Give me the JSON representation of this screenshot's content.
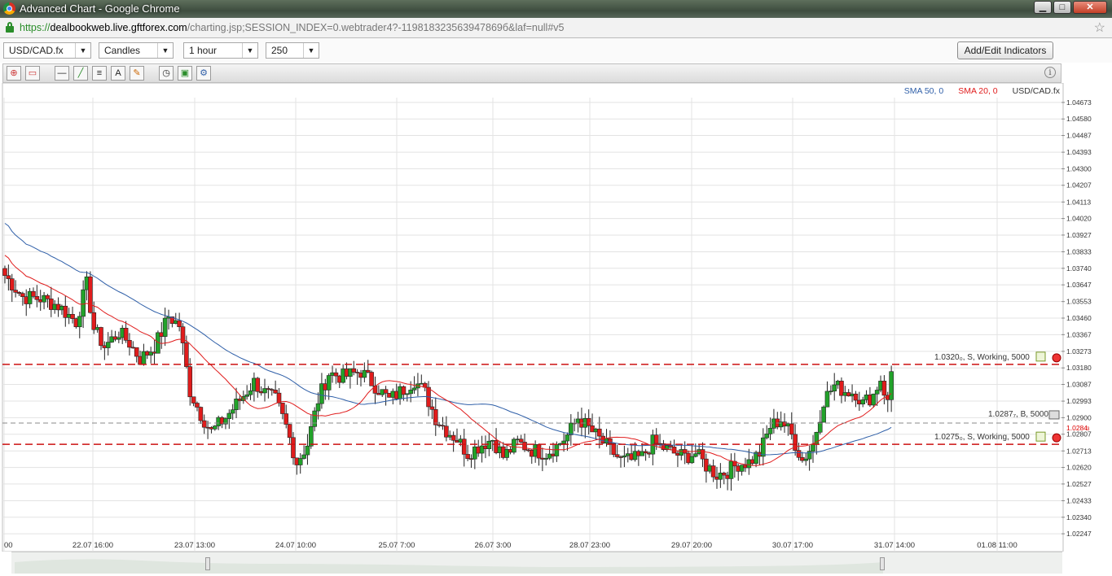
{
  "window": {
    "title": "Advanced Chart - Google Chrome",
    "minimize": "▁",
    "maximize": "□",
    "close": "✕"
  },
  "address": {
    "scheme": "https://",
    "host": "dealbookweb.live.gftforex.com",
    "path": "/charting.jsp;SESSION_INDEX=0.webtrader4?-119818323563947869б&laf=null#v5"
  },
  "toolbar": {
    "symbol": "USD/CAD.fx",
    "chart_type": "Candles",
    "interval": "1 hour",
    "bars": "250",
    "add_indicators": "Add/Edit Indicators"
  },
  "colors": {
    "up": "#22a22a",
    "down": "#e01c1c",
    "sma50": "#2f5fa8",
    "sma20": "#e01c1c",
    "grid": "#e3e3e3"
  },
  "chart_data": {
    "type": "candlestick",
    "legend": [
      {
        "name": "SMA 50, 0",
        "color": "#2f5fa8"
      },
      {
        "name": "SMA 20, 0",
        "color": "#e01c1c"
      },
      {
        "name": "USD/CAD.fx",
        "color": "#333333"
      }
    ],
    "y_ticks": [
      "1.04673",
      "1.04580",
      "1.04487",
      "1.04393",
      "1.04300",
      "1.04207",
      "1.04113",
      "1.04020",
      "1.03927",
      "1.03833",
      "1.03740",
      "1.03647",
      "1.03553",
      "1.03460",
      "1.03367",
      "1.03273",
      "1.03180",
      "1.03087",
      "1.02993",
      "1.02900",
      "1.02807",
      "1.02713",
      "1.02620",
      "1.02527",
      "1.02433",
      "1.02340",
      "1.02247"
    ],
    "ylim": [
      1.0222,
      1.047
    ],
    "x_ticks": [
      "00",
      "22.07 16:00",
      "23.07 13:00",
      "24.07 10:00",
      "25.07 7:00",
      "26.07 3:00",
      "28.07 23:00",
      "29.07 20:00",
      "30.07 17:00",
      "31.07 14:00",
      "01.08 11:00"
    ],
    "bar_count": 250,
    "anchors": [
      [
        0,
        1.037
      ],
      [
        5,
        1.0358
      ],
      [
        10,
        1.0357
      ],
      [
        15,
        1.0353
      ],
      [
        20,
        1.0344
      ],
      [
        23,
        1.0365
      ],
      [
        25,
        1.034
      ],
      [
        28,
        1.033
      ],
      [
        32,
        1.0338
      ],
      [
        35,
        1.0332
      ],
      [
        38,
        1.0323
      ],
      [
        42,
        1.033
      ],
      [
        44,
        1.0338
      ],
      [
        46,
        1.0347
      ],
      [
        49,
        1.0342
      ],
      [
        52,
        1.0305
      ],
      [
        55,
        1.0292
      ],
      [
        58,
        1.0282
      ],
      [
        62,
        1.029
      ],
      [
        66,
        1.03
      ],
      [
        70,
        1.031
      ],
      [
        73,
        1.0304
      ],
      [
        76,
        1.03
      ],
      [
        79,
        1.0285
      ],
      [
        82,
        1.0265
      ],
      [
        85,
        1.0275
      ],
      [
        88,
        1.03
      ],
      [
        91,
        1.0315
      ],
      [
        95,
        1.0313
      ],
      [
        100,
        1.0316
      ],
      [
        104,
        1.0308
      ],
      [
        108,
        1.03
      ],
      [
        112,
        1.0306
      ],
      [
        115,
        1.0311
      ],
      [
        118,
        1.0304
      ],
      [
        121,
        1.029
      ],
      [
        124,
        1.0283
      ],
      [
        127,
        1.0278
      ],
      [
        130,
        1.027
      ],
      [
        134,
        1.0275
      ],
      [
        137,
        1.0278
      ],
      [
        140,
        1.0268
      ],
      [
        144,
        1.0276
      ],
      [
        148,
        1.0272
      ],
      [
        152,
        1.027
      ],
      [
        155,
        1.0274
      ],
      [
        158,
        1.028
      ],
      [
        161,
        1.029
      ],
      [
        164,
        1.0284
      ],
      [
        167,
        1.0278
      ],
      [
        170,
        1.0272
      ],
      [
        173,
        1.0266
      ],
      [
        176,
        1.0266
      ],
      [
        179,
        1.0268
      ],
      [
        182,
        1.0276
      ],
      [
        185,
        1.0273
      ],
      [
        188,
        1.027
      ],
      [
        191,
        1.0268
      ],
      [
        194,
        1.027
      ],
      [
        197,
        1.0263
      ],
      [
        200,
        1.0258
      ],
      [
        203,
        1.026
      ],
      [
        206,
        1.0264
      ],
      [
        209,
        1.0265
      ],
      [
        212,
        1.027
      ],
      [
        215,
        1.0285
      ],
      [
        218,
        1.0289
      ],
      [
        221,
        1.028
      ],
      [
        224,
        1.0266
      ],
      [
        227,
        1.0275
      ],
      [
        230,
        1.03
      ],
      [
        233,
        1.0308
      ],
      [
        236,
        1.0305
      ],
      [
        239,
        1.0304
      ],
      [
        241,
        1.0298
      ],
      [
        244,
        1.0303
      ],
      [
        246,
        1.0312
      ],
      [
        248,
        1.0298
      ],
      [
        249,
        1.0316
      ],
      [
        250,
        1.0284
      ],
      [
        251,
        1.028
      ]
    ],
    "orders": [
      {
        "price": 1.032,
        "label": "1.0320₀, S, Working, 5000",
        "color": "#cc1111",
        "style": "dashed"
      },
      {
        "price": 1.0275,
        "label": "1.0275₀, S, Working, 5000",
        "color": "#cc1111",
        "style": "dashed"
      }
    ],
    "position": {
      "price": 1.0287,
      "label": "1.0287₇, B, 5000",
      "color": "#888888"
    },
    "last_price": {
      "value": "1.0284",
      "marker": "3"
    }
  }
}
